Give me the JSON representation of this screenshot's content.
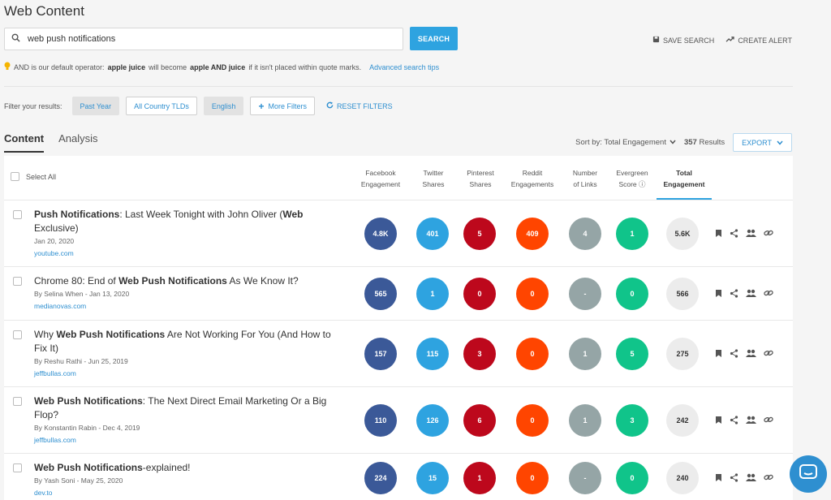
{
  "page": {
    "title": "Web Content"
  },
  "search": {
    "value": "web push notifications",
    "button": "SEARCH"
  },
  "top_actions": {
    "save": "SAVE SEARCH",
    "alert": "CREATE ALERT"
  },
  "hint": {
    "p1": "AND is our default operator:",
    "b1": "apple juice",
    "p2": "will become",
    "b2": "apple AND juice",
    "p3": "if it isn't placed within quote marks.",
    "link": "Advanced search tips"
  },
  "filters": {
    "label": "Filter your results:",
    "chips": [
      "Past Year",
      "All Country TLDs",
      "English",
      "More Filters"
    ],
    "reset": "RESET FILTERS"
  },
  "tabs": [
    "Content",
    "Analysis"
  ],
  "sort": {
    "label": "Sort by: Total Engagement",
    "count": "357",
    "results": "Results",
    "export": "EXPORT"
  },
  "table": {
    "select_all": "Select All",
    "headers": [
      [
        "Facebook",
        "Engagement"
      ],
      [
        "Twitter",
        "Shares"
      ],
      [
        "Pinterest",
        "Shares"
      ],
      [
        "Reddit",
        "Engagements"
      ],
      [
        "Number",
        "of Links"
      ],
      [
        "Evergreen",
        "Score ⓘ"
      ],
      [
        "Total",
        "Engagement"
      ]
    ],
    "rows": [
      {
        "title_parts": [
          [
            "b",
            "Push Notifications"
          ],
          [
            "",
            "Last Week Tonight with John Oliver ("
          ],
          [
            "b",
            "Web"
          ],
          [
            "",
            "Exclusive)"
          ]
        ],
        "title_display": [
          "Push Notifications",
          ": Last Week Tonight with John Oliver (",
          "Web",
          " Exclusive)"
        ],
        "meta": "Jan 20, 2020",
        "domain": "youtube.com",
        "stats": [
          "4.8K",
          "401",
          "5",
          "409",
          "4",
          "1",
          "5.6K"
        ]
      },
      {
        "title_display": [
          "",
          "Chrome 80: End of ",
          "Web Push Notifications",
          " As We Know It?"
        ],
        "meta": "By Selina When - Jan 13, 2020",
        "domain": "medianovas.com",
        "stats": [
          "565",
          "1",
          "0",
          "0",
          "-",
          "0",
          "566"
        ]
      },
      {
        "title_display": [
          "",
          "Why ",
          "Web Push Notifications",
          " Are Not Working For You (And How to Fix It)"
        ],
        "meta": "By Reshu Rathi - Jun 25, 2019",
        "domain": "jeffbullas.com",
        "stats": [
          "157",
          "115",
          "3",
          "0",
          "1",
          "5",
          "275"
        ]
      },
      {
        "title_display": [
          "Web Push Notifications",
          ": The Next Direct Email Marketing Or a Big Flop?",
          "",
          ""
        ],
        "meta": "By Konstantin Rabin - Dec 4, 2019",
        "domain": "jeffbullas.com",
        "stats": [
          "110",
          "126",
          "6",
          "0",
          "1",
          "3",
          "242"
        ]
      },
      {
        "title_display": [
          "Web Push Notifications",
          "-explained!",
          "",
          ""
        ],
        "meta": "By Yash Soni - May 25, 2020",
        "domain": "dev.to",
        "stats": [
          "224",
          "15",
          "1",
          "0",
          "-",
          "0",
          "240"
        ]
      }
    ]
  },
  "colors": {
    "accent": "#2ea3e0",
    "facebook": "#3b5998",
    "twitter": "#2ea3e0",
    "pinterest": "#bd081c",
    "reddit": "#ff4500",
    "links": "#95a5a6",
    "evergreen": "#10c48a"
  }
}
